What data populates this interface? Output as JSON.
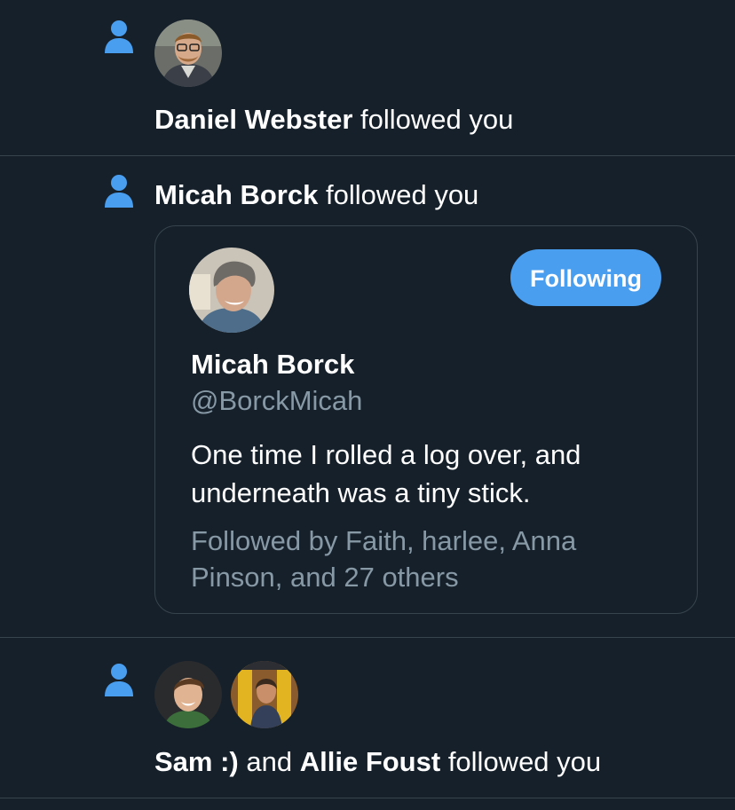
{
  "colors": {
    "background": "#15202b",
    "divider": "#38444d",
    "accent": "#4a9ef0",
    "muted": "#8899a6"
  },
  "notifications": [
    {
      "icon": "person-icon",
      "names": [
        "Daniel Webster"
      ],
      "action": "followed you"
    },
    {
      "icon": "person-icon",
      "names": [
        "Micah Borck"
      ],
      "action": "followed you",
      "card": {
        "name": "Micah Borck",
        "handle": "@BorckMicah",
        "button_label": "Following",
        "bio": "One time I rolled a log over, and underneath was a tiny stick.",
        "followed_by": "Followed by Faith, harlee, Anna Pinson, and 27 others"
      }
    },
    {
      "icon": "person-icon",
      "names": [
        "Sam :)",
        "Allie Foust"
      ],
      "connector": "and",
      "action": "followed you"
    }
  ]
}
